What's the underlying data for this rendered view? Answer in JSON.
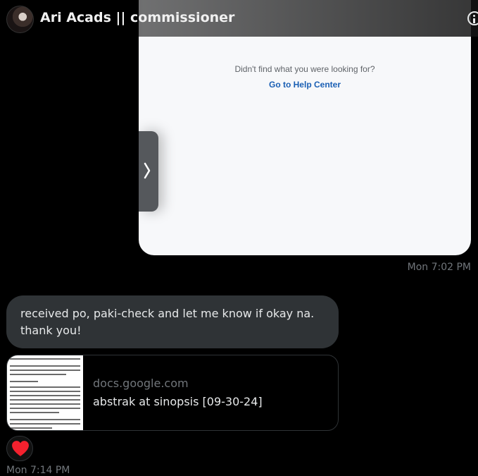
{
  "header": {
    "title": "Ari Acads || commissioner"
  },
  "image_message": {
    "help_question": "Didn't find what you were looking for?",
    "help_link": "Go to Help Center",
    "timestamp": "Mon 7:02 PM"
  },
  "text_message": {
    "text": "received po, paki-check and let me know if okay na. thank you!"
  },
  "link_card": {
    "domain": "docs.google.com",
    "title": "abstrak at sinopsis [09-30-24]"
  },
  "reaction": {
    "icon": "heart-icon",
    "color": "#f91880"
  },
  "footer_timestamp": "Mon 7:14 PM",
  "colors": {
    "background": "#000000",
    "bubble": "#2f3336",
    "muted_text": "#71767b",
    "link_blue": "#1a5fb4"
  }
}
